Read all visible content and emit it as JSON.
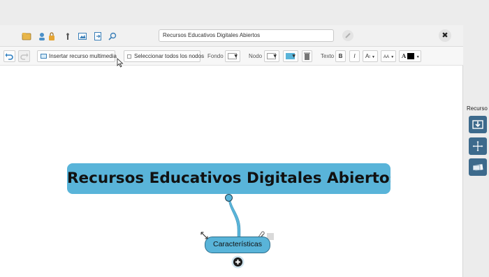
{
  "topbar": {
    "document_title": "Recursos Educativos Digitales Abiertos",
    "icons": [
      "folder-icon",
      "user-lock-icon",
      "tool-icon",
      "image-icon",
      "export-icon",
      "search-icon"
    ],
    "close_label": "✖"
  },
  "toolbar": {
    "undo_icon": "undo-icon",
    "redo_icon": "redo-icon",
    "insert_media_label": "Insertar recurso multimedia",
    "select_all_label": "Seleccionar todos los nodos",
    "fondo_label": "Fondo",
    "nodo_label": "Nodo",
    "texto_label": "Texto",
    "bold_label": "B",
    "italic_label": "I",
    "font_size_label": "A",
    "font_type_label": "A",
    "font_color_label": "A",
    "node_fill_color": "#59b4d9",
    "text_color": "#000000"
  },
  "canvas": {
    "root_node": "Recursos Educativos Digitales Abiertos",
    "child_node": "Características",
    "node_color": "#59b4d9"
  },
  "side_panel": {
    "title": "Recurso",
    "buttons": [
      "download-icon",
      "move-icon",
      "cards-icon"
    ]
  }
}
